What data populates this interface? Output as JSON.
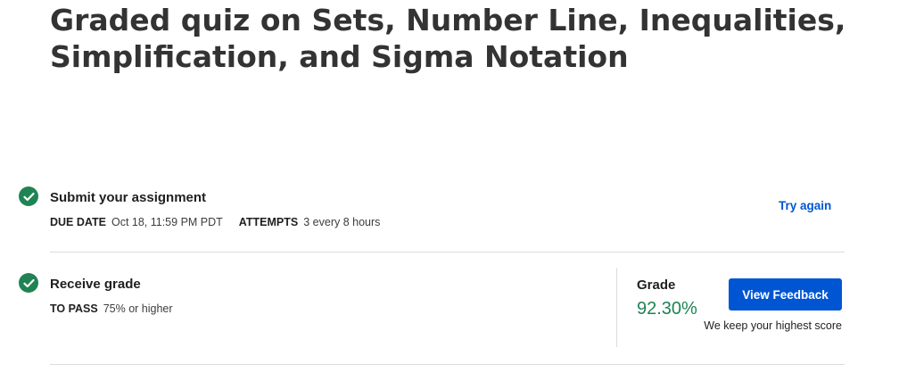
{
  "page": {
    "title": "Graded quiz on Sets, Number Line, Inequalities, Simplification, and Sigma Notation"
  },
  "submit_section": {
    "title": "Submit your assignment",
    "due_date_label": "DUE DATE",
    "due_date_value": "Oct 18, 11:59 PM PDT",
    "attempts_label": "ATTEMPTS",
    "attempts_value": "3 every 8 hours",
    "action_label": "Try again",
    "status_icon": "checkmark-circle-icon"
  },
  "grade_section": {
    "title": "Receive grade",
    "to_pass_label": "TO PASS",
    "to_pass_value": "75% or higher",
    "grade_label": "Grade",
    "grade_value": "92.30%",
    "feedback_button_label": "View Feedback",
    "note": "We keep your highest score",
    "status_icon": "checkmark-circle-icon"
  },
  "colors": {
    "accent_blue": "#0056d2",
    "success_green": "#1f8354",
    "divider": "#dcdcdc"
  }
}
